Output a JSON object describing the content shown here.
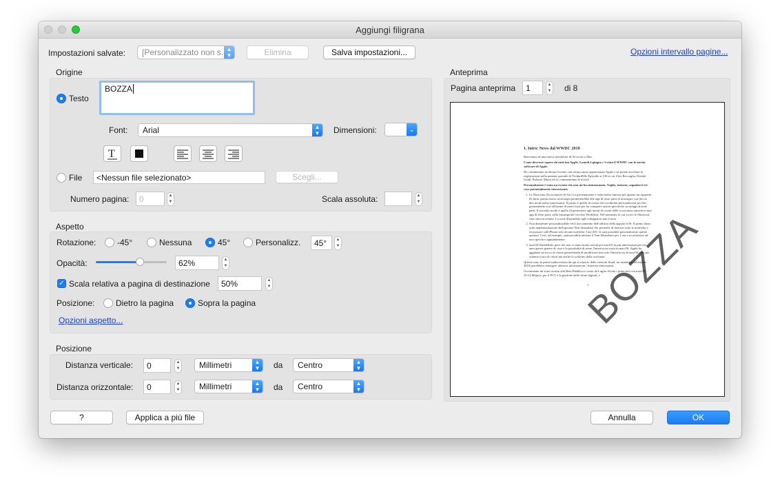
{
  "window": {
    "title": "Aggiungi filigrana"
  },
  "top": {
    "saved_label": "Impostazioni salvate:",
    "saved_value": "[Personalizzato non s...",
    "delete_label": "Elimina",
    "save_label": "Salva impostazioni...",
    "range_link": "Opzioni intervallo pagine..."
  },
  "origin": {
    "title": "Origine",
    "text_label": "Testo",
    "text_value": "BOZZA",
    "font_label": "Font:",
    "font_value": "Arial",
    "size_label": "Dimensioni:",
    "size_value": "",
    "file_label": "File",
    "file_value": "<Nessun file selezionato>",
    "choose_label": "Scegli...",
    "page_number_label": "Numero pagina:",
    "page_number_value": "0",
    "abs_scale_label": "Scala assoluta:",
    "abs_scale_value": ""
  },
  "aspect": {
    "title": "Aspetto",
    "rotation_label": "Rotazione:",
    "rot_minus45": "-45°",
    "rot_none": "Nessuna",
    "rot_45": "45°",
    "rot_custom": "Personalizz.",
    "rot_custom_value": "45°",
    "opacity_label": "Opacità:",
    "opacity_value": "62%",
    "opacity_level": 0.62,
    "scale_label": "Scala relativa a pagina di destinazione",
    "scale_value": "50%",
    "position_label": "Posizione:",
    "behind_label": "Dietro la pagina",
    "over_label": "Sopra la pagina",
    "options_link": "Opzioni aspetto..."
  },
  "position": {
    "title": "Posizione",
    "vertical_label": "Distanza verticale:",
    "vertical_value": "0",
    "vertical_unit": "Millimetri",
    "from_label_v": "da",
    "vertical_from": "Centro",
    "horizontal_label": "Distanza orizzontale:",
    "horizontal_value": "0",
    "horizontal_unit": "Millimetri",
    "from_label_h": "da",
    "horizontal_from": "Centro"
  },
  "preview": {
    "title": "Anteprima",
    "page_label": "Pagina anteprima",
    "page_value": "1",
    "of_label": "di 8",
    "watermark_text": "BOZZA",
    "doc_heading": "1. Intro: News dal WWDC 2018",
    "doc_p1": "Benvenuti ad una nuova newsletter di Avvocati e Mac.",
    "doc_p2": "Come dovreste sapere da tutti fan Apple, Lunedì 4 giugno c'è stato il WWDC con le novità software di Apple.",
    "doc_p3": "Ho commentato in diretta l'evento con alcuni amici appassionati Apple e ne potete ascoltare la registrazione nella puntata speciale di TechnoPillz Episodio n.130 in cui Alex Raccuglia, Davide Guidi, Roberto Marin ed io commentiamo le novità.",
    "doc_p4": "Personalmente è stato un evento che non mi ha entusiasmato. Voglio, tuttavia, segnalarvi tre cose potenzialmente interessanti:",
    "doc_li1": "Le Shortcuts (Scorciatoie) di Siri: La presentazione è stata molto fumosa per quanto mi riguarda. Di fatto questa nuova tecnologia permetterebbe alle app di terze parti di interagire con Siri in due modi molto interessanti. Il primo è quello di creare dei vocabolari personalizzati per Siri permettendo così all'utente di usare frasi per far compiere azioni specifiche su un'app di terze parti. Il secondo modo è quello di permettere agli utenti di creare delle scorciatoie attraverso una app di terze parti, sulla falsariga del vecchio Workflow. Nel momento in cui scrivo le Shortcuts sono ancora in beta. La sorte disponibile agli sviluppatori non è nota.",
    "doc_li2": "Non disturbare personalizzabile ed il tracciamento dell'utilizzo della app per iOS: Il primo dona utile implementazione dell'opzione Non disturbare che permette di mettere sotto le notifiche e far passare sull'iPhone solo alcune notifiche. Con iOS 12 sarà possibile personalizzare queste opzioni. Così, ad esempio, sarà possibile attivare il Non Disturbare per 1 ora o in relazione ad uno specifico appuntamento.",
    "doc_li3": "macOS DarkMode: pare che non ci siano molte novità per macOS la più interessante per chi ama queste genere di cose è la possibilità di avere l'interfaccia scura in macOS. Apple ha aggiunto un tocco di classe permettendo di modificare non solo l'interfaccia di macOS con uno schema scuro di colori ma anche lo schermo della scrivania.",
    "doc_p5": "Queste sono le prime indiscrezioni da qui al rilascio delle versioni finali, tra settembre ed ottobre 2018 potrebbero emergere ulteriori informazioni / funzioni interessanti.",
    "doc_p6": "Ovviamente mi sono iscritto alla Beta Pubblica e conto da Luglio di fare i primi test con macOS 10.14 Mojave, per il PCT e la gestione delle firme digitali, e",
    "doc_page_number": "1"
  },
  "bottom": {
    "help_label": "?",
    "apply_label": "Applica a più file",
    "cancel_label": "Annulla",
    "ok_label": "OK"
  }
}
